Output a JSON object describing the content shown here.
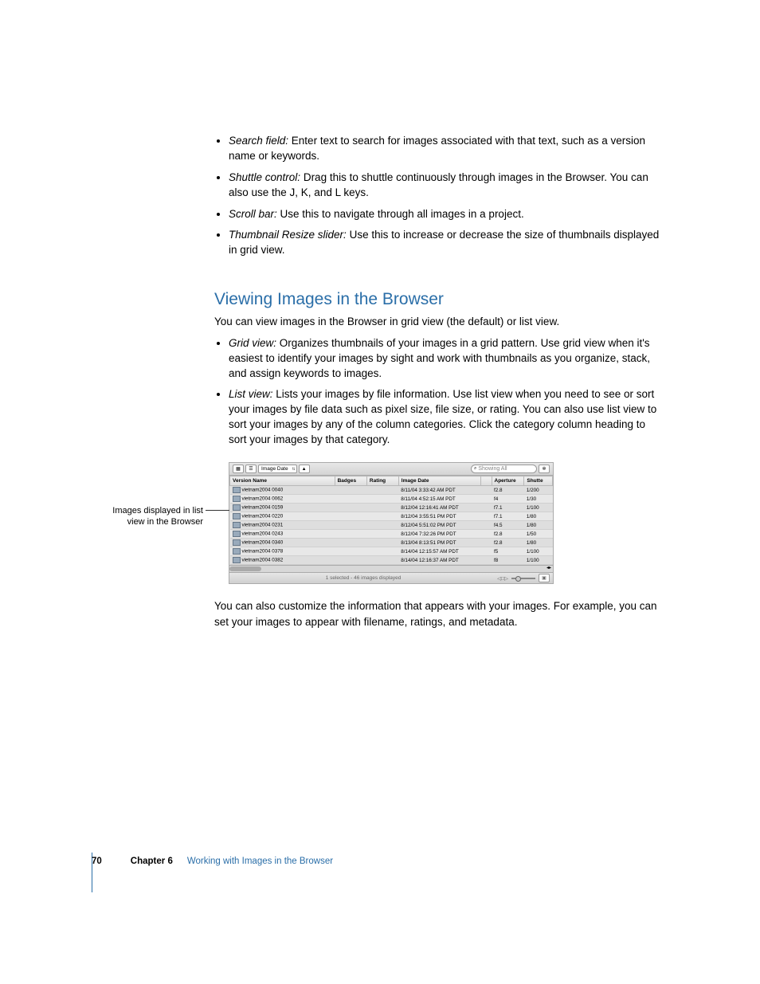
{
  "bullets_top": [
    {
      "term": "Search field:",
      "desc": "  Enter text to search for images associated with that text, such as a version name or keywords."
    },
    {
      "term": "Shuttle control:",
      "desc": "  Drag this to shuttle continuously through images in the Browser. You can also use the J, K, and L keys."
    },
    {
      "term": "Scroll bar:",
      "desc": "  Use this to navigate through all images in a project."
    },
    {
      "term": "Thumbnail Resize slider:",
      "desc": "  Use this to increase or decrease the size of thumbnails displayed in grid view."
    }
  ],
  "heading": "Viewing Images in the Browser",
  "intro": "You can view images in the Browser in grid view (the default) or list view.",
  "bullets_views": [
    {
      "term": "Grid view:",
      "desc": "  Organizes thumbnails of your images in a grid pattern. Use grid view when it's easiest to identify your images by sight and work with thumbnails as you organize, stack, and assign keywords to images."
    },
    {
      "term": "List view:",
      "desc": "  Lists your images by file information. Use list view when you need to see or sort your images by file data such as pixel size, file size, or rating. You can also use list view to sort your images by any of the column categories. Click the category column heading to sort your images by that category."
    }
  ],
  "callout": "Images displayed in list view in the Browser",
  "browser": {
    "sort_field": "Image Date",
    "search_placeholder": "Showing All",
    "columns": [
      "Version Name",
      "Badges",
      "Rating",
      "Image Date",
      "",
      "Aperture",
      "Shutte"
    ],
    "rows": [
      {
        "name": "vietnam2004 0040",
        "date": "8/11/04 3:33:42 AM PDT",
        "ap": "f2.8",
        "sh": "1/200"
      },
      {
        "name": "vietnam2004 0062",
        "date": "8/11/04 4:52:15 AM PDT",
        "ap": "f4",
        "sh": "1/30"
      },
      {
        "name": "vietnam2004 0159",
        "date": "8/12/04 12:16:41 AM PDT",
        "ap": "f7.1",
        "sh": "1/100"
      },
      {
        "name": "vietnam2004 0220",
        "date": "8/12/04 3:55:51 PM PDT",
        "ap": "f7.1",
        "sh": "1/80"
      },
      {
        "name": "vietnam2004 0231",
        "date": "8/12/04 5:51:02 PM PDT",
        "ap": "f4.5",
        "sh": "1/80"
      },
      {
        "name": "vietnam2004 0243",
        "date": "8/12/04 7:32:26 PM PDT",
        "ap": "f2.8",
        "sh": "1/50"
      },
      {
        "name": "vietnam2004 0340",
        "date": "8/13/04 8:13:51 PM PDT",
        "ap": "f2.8",
        "sh": "1/80"
      },
      {
        "name": "vietnam2004 0378",
        "date": "8/14/04 12:15:57 AM PDT",
        "ap": "f5",
        "sh": "1/100"
      },
      {
        "name": "vietnam2004 0382",
        "date": "8/14/04 12:16:37 AM PDT",
        "ap": "f8",
        "sh": "1/100"
      }
    ],
    "status": "1 selected - 46 images displayed"
  },
  "after_screenshot": "You can also customize the information that appears with your images. For example, you can set your images to appear with filename, ratings, and metadata.",
  "footer": {
    "page": "70",
    "chapter_label": "Chapter 6",
    "chapter_title": "Working with Images in the Browser"
  }
}
